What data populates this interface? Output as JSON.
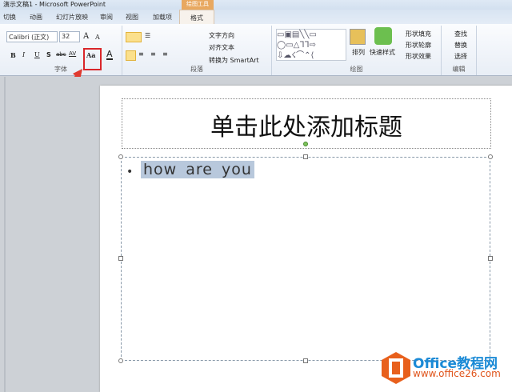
{
  "window": {
    "title": "演示文稿1 - Microsoft PowerPoint",
    "context_tab": "绘图工具"
  },
  "tabs": [
    "切换",
    "动画",
    "幻灯片放映",
    "审阅",
    "视图",
    "加载项",
    "格式"
  ],
  "ribbon": {
    "font": {
      "label": "字体",
      "font_name": "Calibri (正文)",
      "font_size": "32",
      "bold": "B",
      "italic": "I",
      "underline": "U",
      "shadow": "S",
      "strike": "abc",
      "spacing": "AV",
      "change_case": "Aa",
      "font_color": "A",
      "grow": "A",
      "shrink": "A"
    },
    "paragraph": {
      "label": "段落",
      "text_direction": "文字方向",
      "align_text": "对齐文本",
      "smartart": "转换为 SmartArt"
    },
    "drawing": {
      "label": "绘图",
      "arrange": "排列",
      "quick_styles": "快速样式",
      "fill": "形状填充",
      "outline": "形状轮廓",
      "effects": "形状效果"
    },
    "editing": {
      "label": "编辑",
      "find": "查找",
      "replace": "替换",
      "select": "选择"
    }
  },
  "slide": {
    "title_placeholder": "单击此处添加标题",
    "bullet": "•",
    "body_text": "how are you"
  },
  "watermark": {
    "brand": "Office教程网",
    "url": "www.office26.com"
  },
  "colors": {
    "highlight_box": "#d9262a",
    "selection": "#b8c8dc",
    "context_tab": "#e8a860"
  }
}
